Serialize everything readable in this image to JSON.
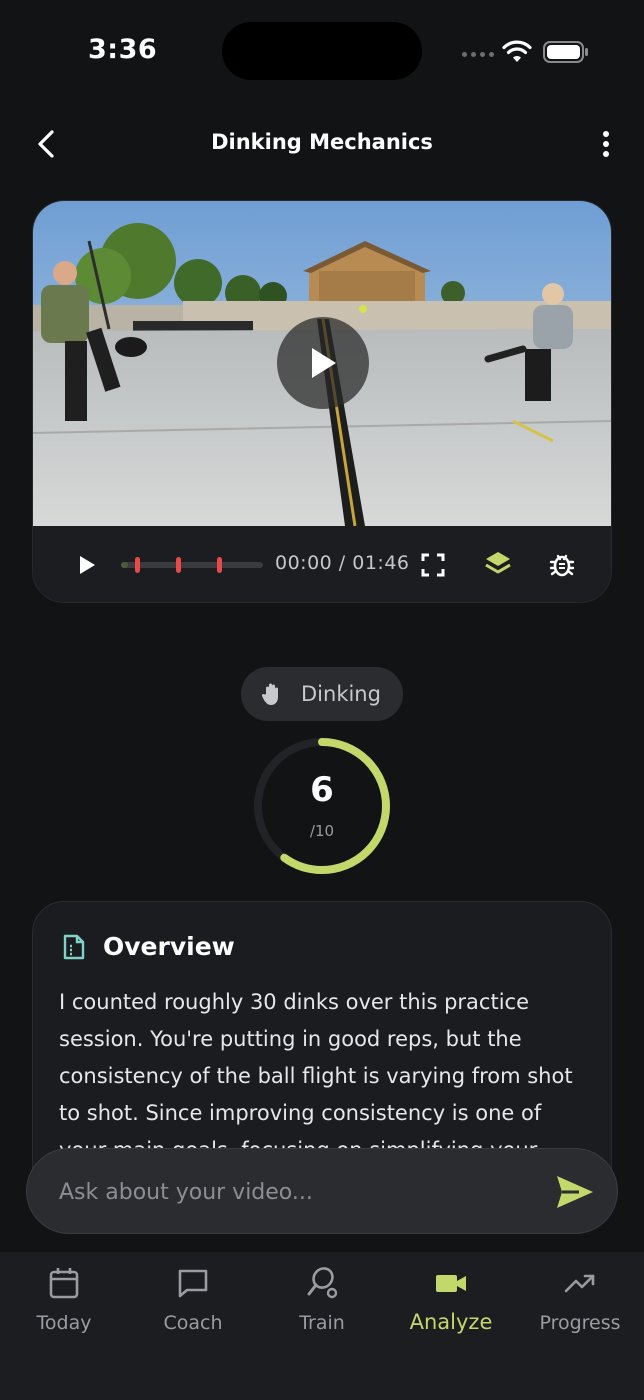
{
  "status_bar": {
    "time": "3:36"
  },
  "header": {
    "title": "Dinking Mechanics"
  },
  "video": {
    "time_current": "00:00",
    "time_total": "01:46",
    "time_separator": " / ",
    "progress": 0.05,
    "markers": [
      0.11,
      0.4,
      0.69
    ]
  },
  "category_chip": {
    "label": "Dinking"
  },
  "score": {
    "value": "6",
    "max": "/10",
    "fraction": 0.6
  },
  "overview": {
    "title": "Overview",
    "text": "I counted roughly 30 dinks over this practice session. You're putting in good reps, but the consistency of the ball flight is varying from shot to shot. Since improving consistency is one of your main goals, focusing on simplifying your mechanics will help."
  },
  "ask": {
    "placeholder": "Ask about your video..."
  },
  "nav": {
    "items": [
      {
        "label": "Today",
        "icon": "calendar-icon"
      },
      {
        "label": "Coach",
        "icon": "chat-icon"
      },
      {
        "label": "Train",
        "icon": "paddle-icon"
      },
      {
        "label": "Analyze",
        "icon": "video-camera-icon"
      },
      {
        "label": "Progress",
        "icon": "trend-up-icon"
      }
    ],
    "active": "Analyze"
  },
  "colors": {
    "accent": "#c2d86a",
    "marker": "#e84a4a",
    "overview_icon": "#7fd3c8"
  }
}
